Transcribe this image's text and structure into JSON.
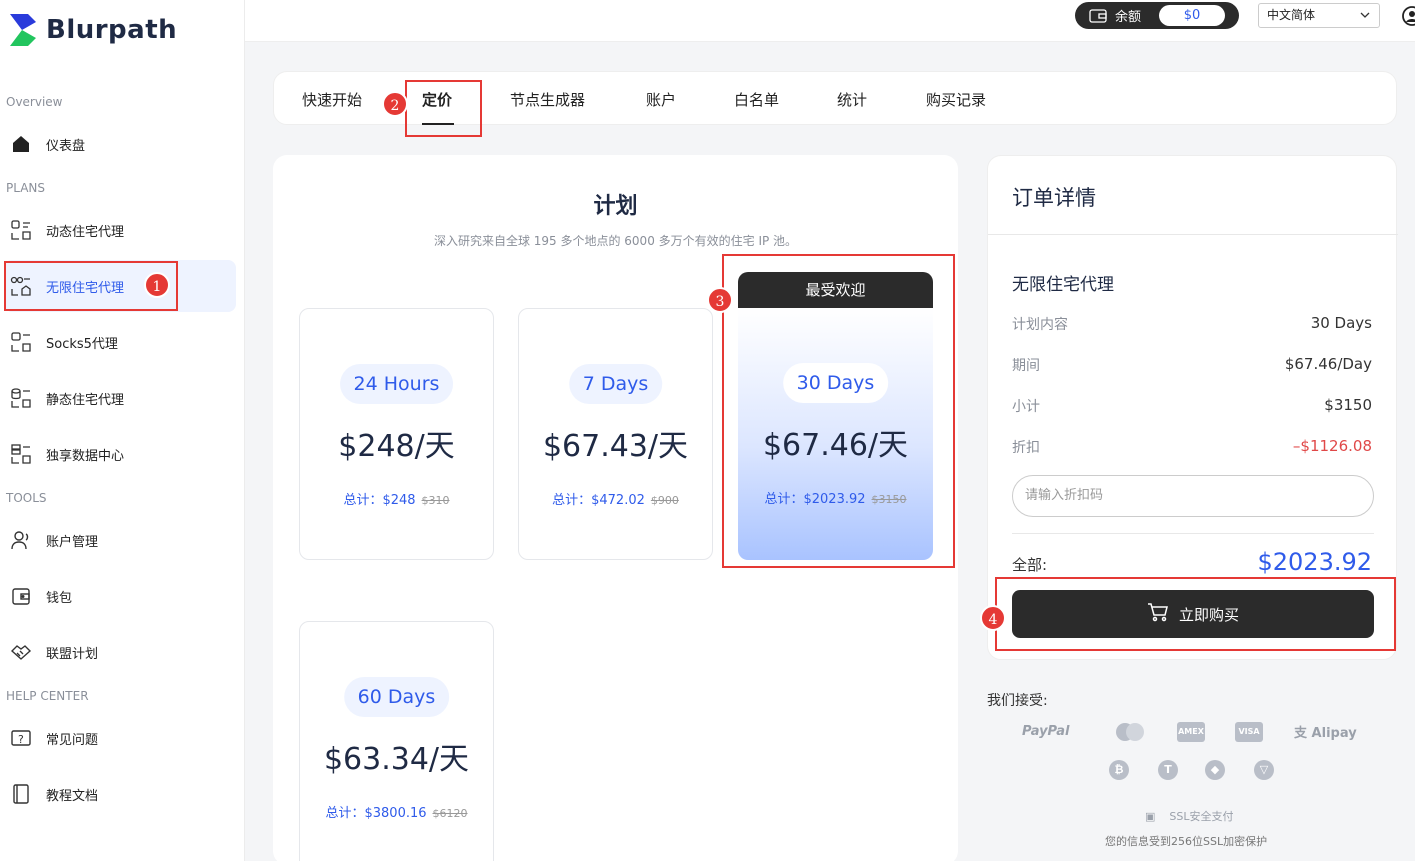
{
  "brand": {
    "name": "Blurpath"
  },
  "sidebar": {
    "sections": [
      {
        "label": "Overview"
      },
      {
        "label": "PLANS"
      },
      {
        "label": "TOOLS"
      },
      {
        "label": "HELP CENTER"
      }
    ],
    "items": [
      {
        "label": "仪表盘",
        "icon": "home-icon"
      },
      {
        "label": "动态住宅代理",
        "icon": "proxy-icon"
      },
      {
        "label": "无限住宅代理",
        "icon": "infinite-proxy-icon",
        "active": true
      },
      {
        "label": "Socks5代理",
        "icon": "socks5-icon"
      },
      {
        "label": "静态住宅代理",
        "icon": "static-proxy-icon"
      },
      {
        "label": "独享数据中心",
        "icon": "datacenter-icon"
      },
      {
        "label": "账户管理",
        "icon": "user-icon"
      },
      {
        "label": "钱包",
        "icon": "wallet-icon"
      },
      {
        "label": "联盟计划",
        "icon": "handshake-icon"
      },
      {
        "label": "常见问题",
        "icon": "faq-icon"
      },
      {
        "label": "教程文档",
        "icon": "docs-icon"
      }
    ]
  },
  "topbar": {
    "balance_label": "余额",
    "balance_value": "$0",
    "language": "中文简体"
  },
  "tabs": [
    {
      "label": "快速开始"
    },
    {
      "label": "定价",
      "active": true
    },
    {
      "label": "节点生成器"
    },
    {
      "label": "账户"
    },
    {
      "label": "白名单"
    },
    {
      "label": "统计"
    },
    {
      "label": "购买记录"
    }
  ],
  "plans": {
    "title": "计划",
    "subtitle": "深入研究来自全球 195 多个地点的 6000 多万个有效的住宅 IP 池。",
    "featured_badge": "最受欢迎",
    "cards": [
      {
        "duration": "24 Hours",
        "price": "$248/天",
        "total_label": "总计：$248",
        "original": "$310"
      },
      {
        "duration": "7 Days",
        "price": "$67.43/天",
        "total_label": "总计：$472.02",
        "original": "$900"
      },
      {
        "duration": "30 Days",
        "price": "$67.46/天",
        "total_label": "总计：$2023.92",
        "original": "$3150",
        "featured": true
      },
      {
        "duration": "60 Days",
        "price": "$63.34/天",
        "total_label": "总计：$3800.16",
        "original": "$6120"
      }
    ]
  },
  "order": {
    "title": "订单详情",
    "plan_name": "无限住宅代理",
    "rows": [
      {
        "label": "计划内容",
        "value": "30 Days"
      },
      {
        "label": "期间",
        "value": "$67.46/Day"
      },
      {
        "label": "小计",
        "value": "$3150"
      },
      {
        "label": "折扣",
        "value": "–$1126.08"
      }
    ],
    "coupon_placeholder": "请输入折扣码",
    "total_label": "全部:",
    "total_value": "$2023.92",
    "buy_label": "立即购买"
  },
  "payments": {
    "accept_label": "我们接受:",
    "methods": [
      "PayPal",
      "AMEX",
      "VISA",
      "Alipay"
    ],
    "crypto_icons": [
      "bitcoin-icon",
      "tether-icon",
      "ethereum-icon",
      "tron-icon"
    ],
    "ssl_label": "SSL安全支付",
    "ssl_note": "您的信息受到256位SSL加密保护"
  },
  "annotations": [
    "1",
    "2",
    "3",
    "4"
  ],
  "colors": {
    "accent": "#2f5bea",
    "dark": "#2b2b2b",
    "annotation": "#e53935",
    "discount": "#e04848"
  }
}
